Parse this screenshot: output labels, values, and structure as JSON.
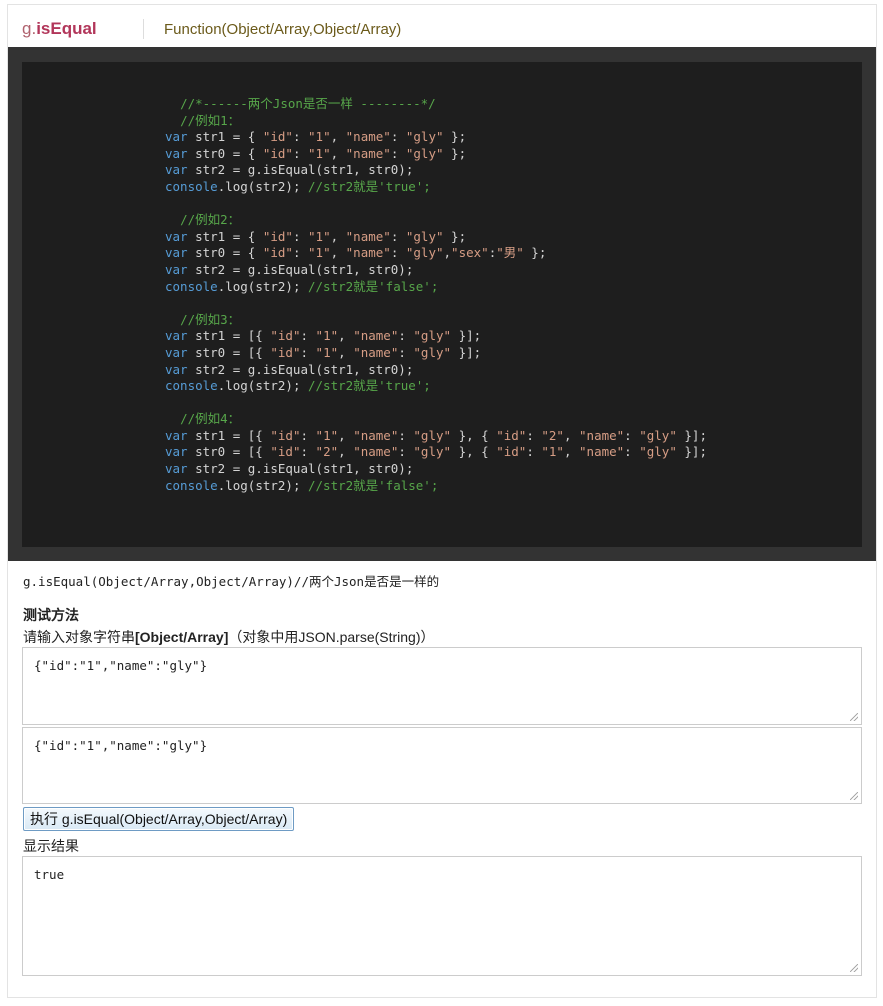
{
  "header": {
    "prefix": "g.",
    "name": "isEqual",
    "signature": "Function(Object/Array,Object/Array)"
  },
  "code_lines": [
    [
      {
        "t": "  ",
        "c": "id"
      },
      {
        "t": "//*------两个Json是否一样 --------*/",
        "c": "com"
      }
    ],
    [
      {
        "t": "  ",
        "c": "id"
      },
      {
        "t": "//例如1：",
        "c": "com"
      }
    ],
    [
      {
        "t": "var",
        "c": "kw"
      },
      {
        "t": " str1 = { ",
        "c": "id"
      },
      {
        "t": "\"id\"",
        "c": "str"
      },
      {
        "t": ": ",
        "c": "id"
      },
      {
        "t": "\"1\"",
        "c": "str"
      },
      {
        "t": ", ",
        "c": "id"
      },
      {
        "t": "\"name\"",
        "c": "str"
      },
      {
        "t": ": ",
        "c": "id"
      },
      {
        "t": "\"gly\"",
        "c": "str"
      },
      {
        "t": " };",
        "c": "id"
      }
    ],
    [
      {
        "t": "var",
        "c": "kw"
      },
      {
        "t": " str0 = { ",
        "c": "id"
      },
      {
        "t": "\"id\"",
        "c": "str"
      },
      {
        "t": ": ",
        "c": "id"
      },
      {
        "t": "\"1\"",
        "c": "str"
      },
      {
        "t": ", ",
        "c": "id"
      },
      {
        "t": "\"name\"",
        "c": "str"
      },
      {
        "t": ": ",
        "c": "id"
      },
      {
        "t": "\"gly\"",
        "c": "str"
      },
      {
        "t": " };",
        "c": "id"
      }
    ],
    [
      {
        "t": "var",
        "c": "kw"
      },
      {
        "t": " str2 = g.isEqual(str1, str0);",
        "c": "id"
      }
    ],
    [
      {
        "t": "console",
        "c": "kw"
      },
      {
        "t": ".log(str2); ",
        "c": "id"
      },
      {
        "t": "//str2就是'true';",
        "c": "com"
      }
    ],
    [
      {
        "t": "",
        "c": "id"
      }
    ],
    [
      {
        "t": "  ",
        "c": "id"
      },
      {
        "t": "//例如2：",
        "c": "com"
      }
    ],
    [
      {
        "t": "var",
        "c": "kw"
      },
      {
        "t": " str1 = { ",
        "c": "id"
      },
      {
        "t": "\"id\"",
        "c": "str"
      },
      {
        "t": ": ",
        "c": "id"
      },
      {
        "t": "\"1\"",
        "c": "str"
      },
      {
        "t": ", ",
        "c": "id"
      },
      {
        "t": "\"name\"",
        "c": "str"
      },
      {
        "t": ": ",
        "c": "id"
      },
      {
        "t": "\"gly\"",
        "c": "str"
      },
      {
        "t": " };",
        "c": "id"
      }
    ],
    [
      {
        "t": "var",
        "c": "kw"
      },
      {
        "t": " str0 = { ",
        "c": "id"
      },
      {
        "t": "\"id\"",
        "c": "str"
      },
      {
        "t": ": ",
        "c": "id"
      },
      {
        "t": "\"1\"",
        "c": "str"
      },
      {
        "t": ", ",
        "c": "id"
      },
      {
        "t": "\"name\"",
        "c": "str"
      },
      {
        "t": ": ",
        "c": "id"
      },
      {
        "t": "\"gly\"",
        "c": "str"
      },
      {
        "t": ",",
        "c": "id"
      },
      {
        "t": "\"sex\"",
        "c": "str"
      },
      {
        "t": ":",
        "c": "id"
      },
      {
        "t": "\"男\"",
        "c": "str"
      },
      {
        "t": " };",
        "c": "id"
      }
    ],
    [
      {
        "t": "var",
        "c": "kw"
      },
      {
        "t": " str2 = g.isEqual(str1, str0);",
        "c": "id"
      }
    ],
    [
      {
        "t": "console",
        "c": "kw"
      },
      {
        "t": ".log(str2); ",
        "c": "id"
      },
      {
        "t": "//str2就是'false';",
        "c": "com"
      }
    ],
    [
      {
        "t": "",
        "c": "id"
      }
    ],
    [
      {
        "t": "  ",
        "c": "id"
      },
      {
        "t": "//例如3：",
        "c": "com"
      }
    ],
    [
      {
        "t": "var",
        "c": "kw"
      },
      {
        "t": " str1 = [{ ",
        "c": "id"
      },
      {
        "t": "\"id\"",
        "c": "str"
      },
      {
        "t": ": ",
        "c": "id"
      },
      {
        "t": "\"1\"",
        "c": "str"
      },
      {
        "t": ", ",
        "c": "id"
      },
      {
        "t": "\"name\"",
        "c": "str"
      },
      {
        "t": ": ",
        "c": "id"
      },
      {
        "t": "\"gly\"",
        "c": "str"
      },
      {
        "t": " }];",
        "c": "id"
      }
    ],
    [
      {
        "t": "var",
        "c": "kw"
      },
      {
        "t": " str0 = [{ ",
        "c": "id"
      },
      {
        "t": "\"id\"",
        "c": "str"
      },
      {
        "t": ": ",
        "c": "id"
      },
      {
        "t": "\"1\"",
        "c": "str"
      },
      {
        "t": ", ",
        "c": "id"
      },
      {
        "t": "\"name\"",
        "c": "str"
      },
      {
        "t": ": ",
        "c": "id"
      },
      {
        "t": "\"gly\"",
        "c": "str"
      },
      {
        "t": " }];",
        "c": "id"
      }
    ],
    [
      {
        "t": "var",
        "c": "kw"
      },
      {
        "t": " str2 = g.isEqual(str1, str0);",
        "c": "id"
      }
    ],
    [
      {
        "t": "console",
        "c": "kw"
      },
      {
        "t": ".log(str2); ",
        "c": "id"
      },
      {
        "t": "//str2就是'true';",
        "c": "com"
      }
    ],
    [
      {
        "t": "",
        "c": "id"
      }
    ],
    [
      {
        "t": "  ",
        "c": "id"
      },
      {
        "t": "//例如4：",
        "c": "com"
      }
    ],
    [
      {
        "t": "var",
        "c": "kw"
      },
      {
        "t": " str1 = [{ ",
        "c": "id"
      },
      {
        "t": "\"id\"",
        "c": "str"
      },
      {
        "t": ": ",
        "c": "id"
      },
      {
        "t": "\"1\"",
        "c": "str"
      },
      {
        "t": ", ",
        "c": "id"
      },
      {
        "t": "\"name\"",
        "c": "str"
      },
      {
        "t": ": ",
        "c": "id"
      },
      {
        "t": "\"gly\"",
        "c": "str"
      },
      {
        "t": " }, { ",
        "c": "id"
      },
      {
        "t": "\"id\"",
        "c": "str"
      },
      {
        "t": ": ",
        "c": "id"
      },
      {
        "t": "\"2\"",
        "c": "str"
      },
      {
        "t": ", ",
        "c": "id"
      },
      {
        "t": "\"name\"",
        "c": "str"
      },
      {
        "t": ": ",
        "c": "id"
      },
      {
        "t": "\"gly\"",
        "c": "str"
      },
      {
        "t": " }];",
        "c": "id"
      }
    ],
    [
      {
        "t": "var",
        "c": "kw"
      },
      {
        "t": " str0 = [{ ",
        "c": "id"
      },
      {
        "t": "\"id\"",
        "c": "str"
      },
      {
        "t": ": ",
        "c": "id"
      },
      {
        "t": "\"2\"",
        "c": "str"
      },
      {
        "t": ", ",
        "c": "id"
      },
      {
        "t": "\"name\"",
        "c": "str"
      },
      {
        "t": ": ",
        "c": "id"
      },
      {
        "t": "\"gly\"",
        "c": "str"
      },
      {
        "t": " }, { ",
        "c": "id"
      },
      {
        "t": "\"id\"",
        "c": "str"
      },
      {
        "t": ": ",
        "c": "id"
      },
      {
        "t": "\"1\"",
        "c": "str"
      },
      {
        "t": ", ",
        "c": "id"
      },
      {
        "t": "\"name\"",
        "c": "str"
      },
      {
        "t": ": ",
        "c": "id"
      },
      {
        "t": "\"gly\"",
        "c": "str"
      },
      {
        "t": " }];",
        "c": "id"
      }
    ],
    [
      {
        "t": "var",
        "c": "kw"
      },
      {
        "t": " str2 = g.isEqual(str1, str0);",
        "c": "id"
      }
    ],
    [
      {
        "t": "console",
        "c": "kw"
      },
      {
        "t": ".log(str2); ",
        "c": "id"
      },
      {
        "t": "//str2就是'false';",
        "c": "com"
      }
    ]
  ],
  "description": "g.isEqual(Object/Array,Object/Array)//两个Json是否是一样的",
  "test": {
    "title": "测试方法",
    "hint_prefix": "请输入对象字符串",
    "hint_bold": "[Object/Array]",
    "hint_suffix": "（对象中用JSON.parse(String)）",
    "input1_value": "{\"id\":\"1\",\"name\":\"gly\"}",
    "input2_value": "{\"id\":\"1\",\"name\":\"gly\"}",
    "run_button": "执行 g.isEqual(Object/Array,Object/Array)",
    "result_label": "显示结果",
    "result_value": "true"
  },
  "colors": {
    "brand": "#b2365a",
    "signature": "#6b5a1a",
    "code_bg": "#1e1e1e",
    "code_frame": "#333333",
    "comment": "#57a64a",
    "keyword": "#569cd6",
    "string": "#d69d85"
  },
  "icons": {
    "resize_grip": "resize-grip-icon"
  }
}
